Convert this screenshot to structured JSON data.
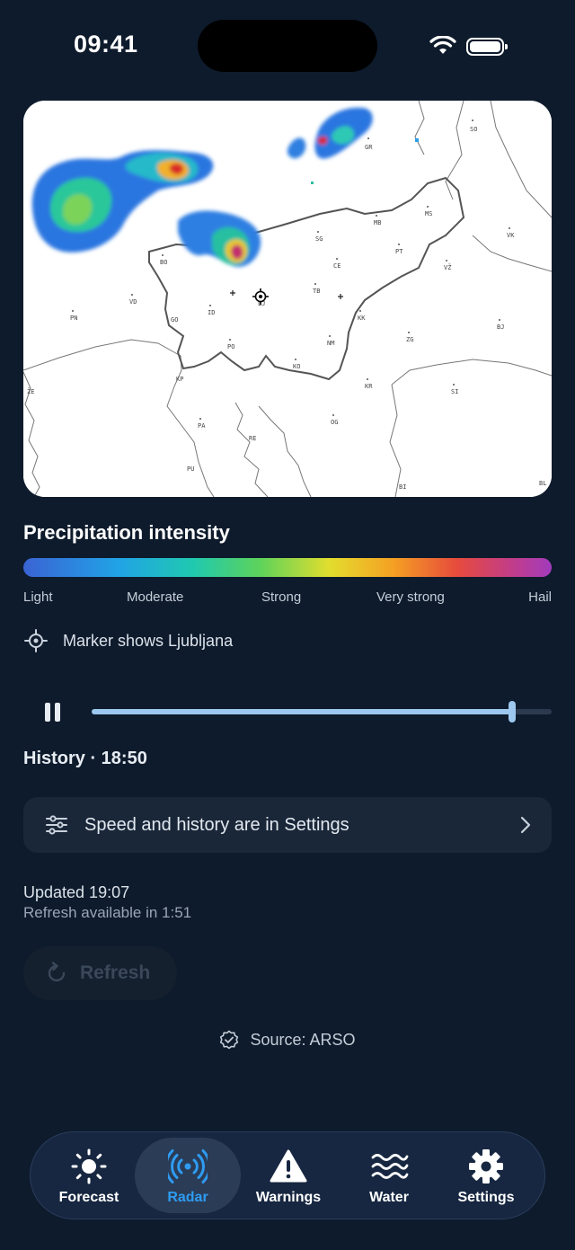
{
  "status_bar": {
    "time": "09:41"
  },
  "radar": {
    "map_labels": [
      "SO",
      "GR",
      "VK",
      "MS",
      "MB",
      "PT",
      "SG",
      "CE",
      "VŽ",
      "BO",
      "VD",
      "PN",
      "TB",
      "LJ",
      "ID",
      "KK",
      "BJ",
      "GO",
      "NM",
      "ZG",
      "PO",
      "KO",
      "KP",
      "KR",
      "SI",
      "PA",
      "OG",
      "RE",
      "PU",
      "BI",
      "BL",
      "ŽE"
    ]
  },
  "legend": {
    "title": "Precipitation intensity",
    "labels": [
      "Light",
      "Moderate",
      "Strong",
      "Very strong",
      "Hail"
    ],
    "marker_note": "Marker shows Ljubljana",
    "colors": [
      "#3a63d4",
      "#21a3e6",
      "#1fc9b0",
      "#5fd35a",
      "#e3dd2e",
      "#f5a023",
      "#e64b3c",
      "#c33d86",
      "#a23bbd"
    ]
  },
  "playback": {
    "state": "playing",
    "progress_fraction": 0.915,
    "history_label": "History · 18:50"
  },
  "settings_link": {
    "label": "Speed and history are in Settings"
  },
  "update": {
    "updated": "Updated 19:07",
    "refresh_available": "Refresh available in 1:51",
    "refresh_button": "Refresh",
    "refresh_enabled": false
  },
  "source": {
    "label": "Source: ARSO"
  },
  "tabs": [
    {
      "label": "Forecast",
      "icon": "sun-icon",
      "active": false
    },
    {
      "label": "Radar",
      "icon": "radar-icon",
      "active": true
    },
    {
      "label": "Warnings",
      "icon": "warning-icon",
      "active": false
    },
    {
      "label": "Water",
      "icon": "waves-icon",
      "active": false
    },
    {
      "label": "Settings",
      "icon": "gear-icon",
      "active": false
    }
  ],
  "colors": {
    "background": "#0e1b2c",
    "accent": "#2e9cf2",
    "slider": "#9cc8ef"
  }
}
